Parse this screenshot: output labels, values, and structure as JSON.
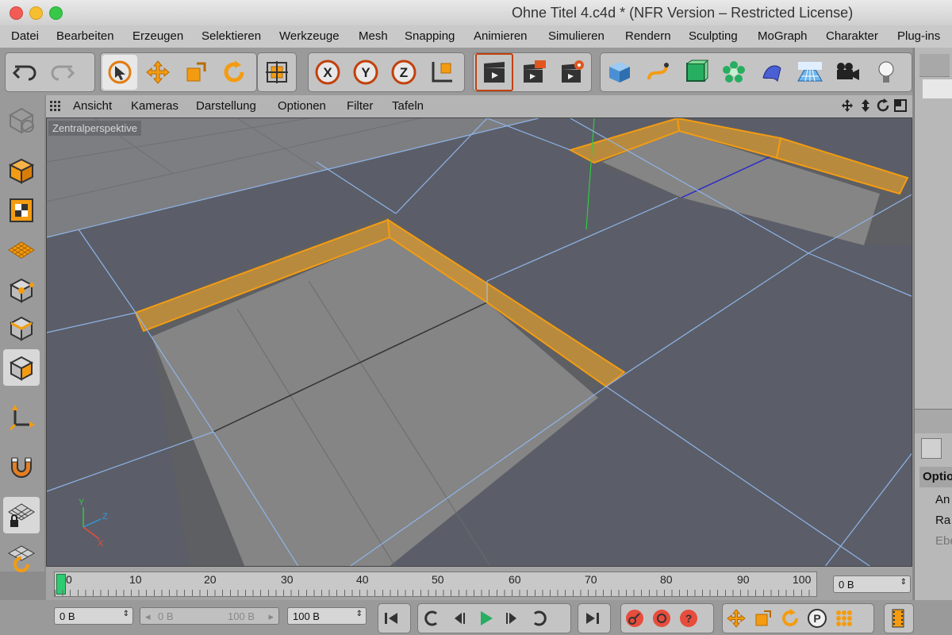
{
  "window": {
    "title": "Ohne Titel 4.c4d * (NFR Version – Restricted License)"
  },
  "menu": [
    "Datei",
    "Bearbeiten",
    "Erzeugen",
    "Selektieren",
    "Werkzeuge",
    "Mesh",
    "Snapping",
    "Animieren",
    "Simulieren",
    "Rendern",
    "Sculpting",
    "MoGraph",
    "Charakter",
    "Plug-ins"
  ],
  "viewport": {
    "menu": [
      "Ansicht",
      "Kameras",
      "Darstellung",
      "Optionen",
      "Filter",
      "Tafeln"
    ],
    "label": "Zentralperspektive",
    "axis": {
      "x": "X",
      "y": "Y",
      "z": "Z"
    }
  },
  "timeline": {
    "ticks": [
      "0",
      "10",
      "20",
      "30",
      "40",
      "50",
      "60",
      "70",
      "80",
      "90",
      "100"
    ],
    "current_field": "0 B"
  },
  "playback": {
    "start_field": "0 B",
    "range_start": "0 B",
    "range_end": "100 B",
    "end_field": "100 B"
  },
  "right_panel": {
    "opt": "Optio",
    "an": "An",
    "ra": "Ra",
    "eb": "Ebe"
  },
  "colors": {
    "accent": "#f39c12",
    "selection": "#f7a21b",
    "edge": "#8fb4e8",
    "viewport_bg": "#5b5e68"
  }
}
